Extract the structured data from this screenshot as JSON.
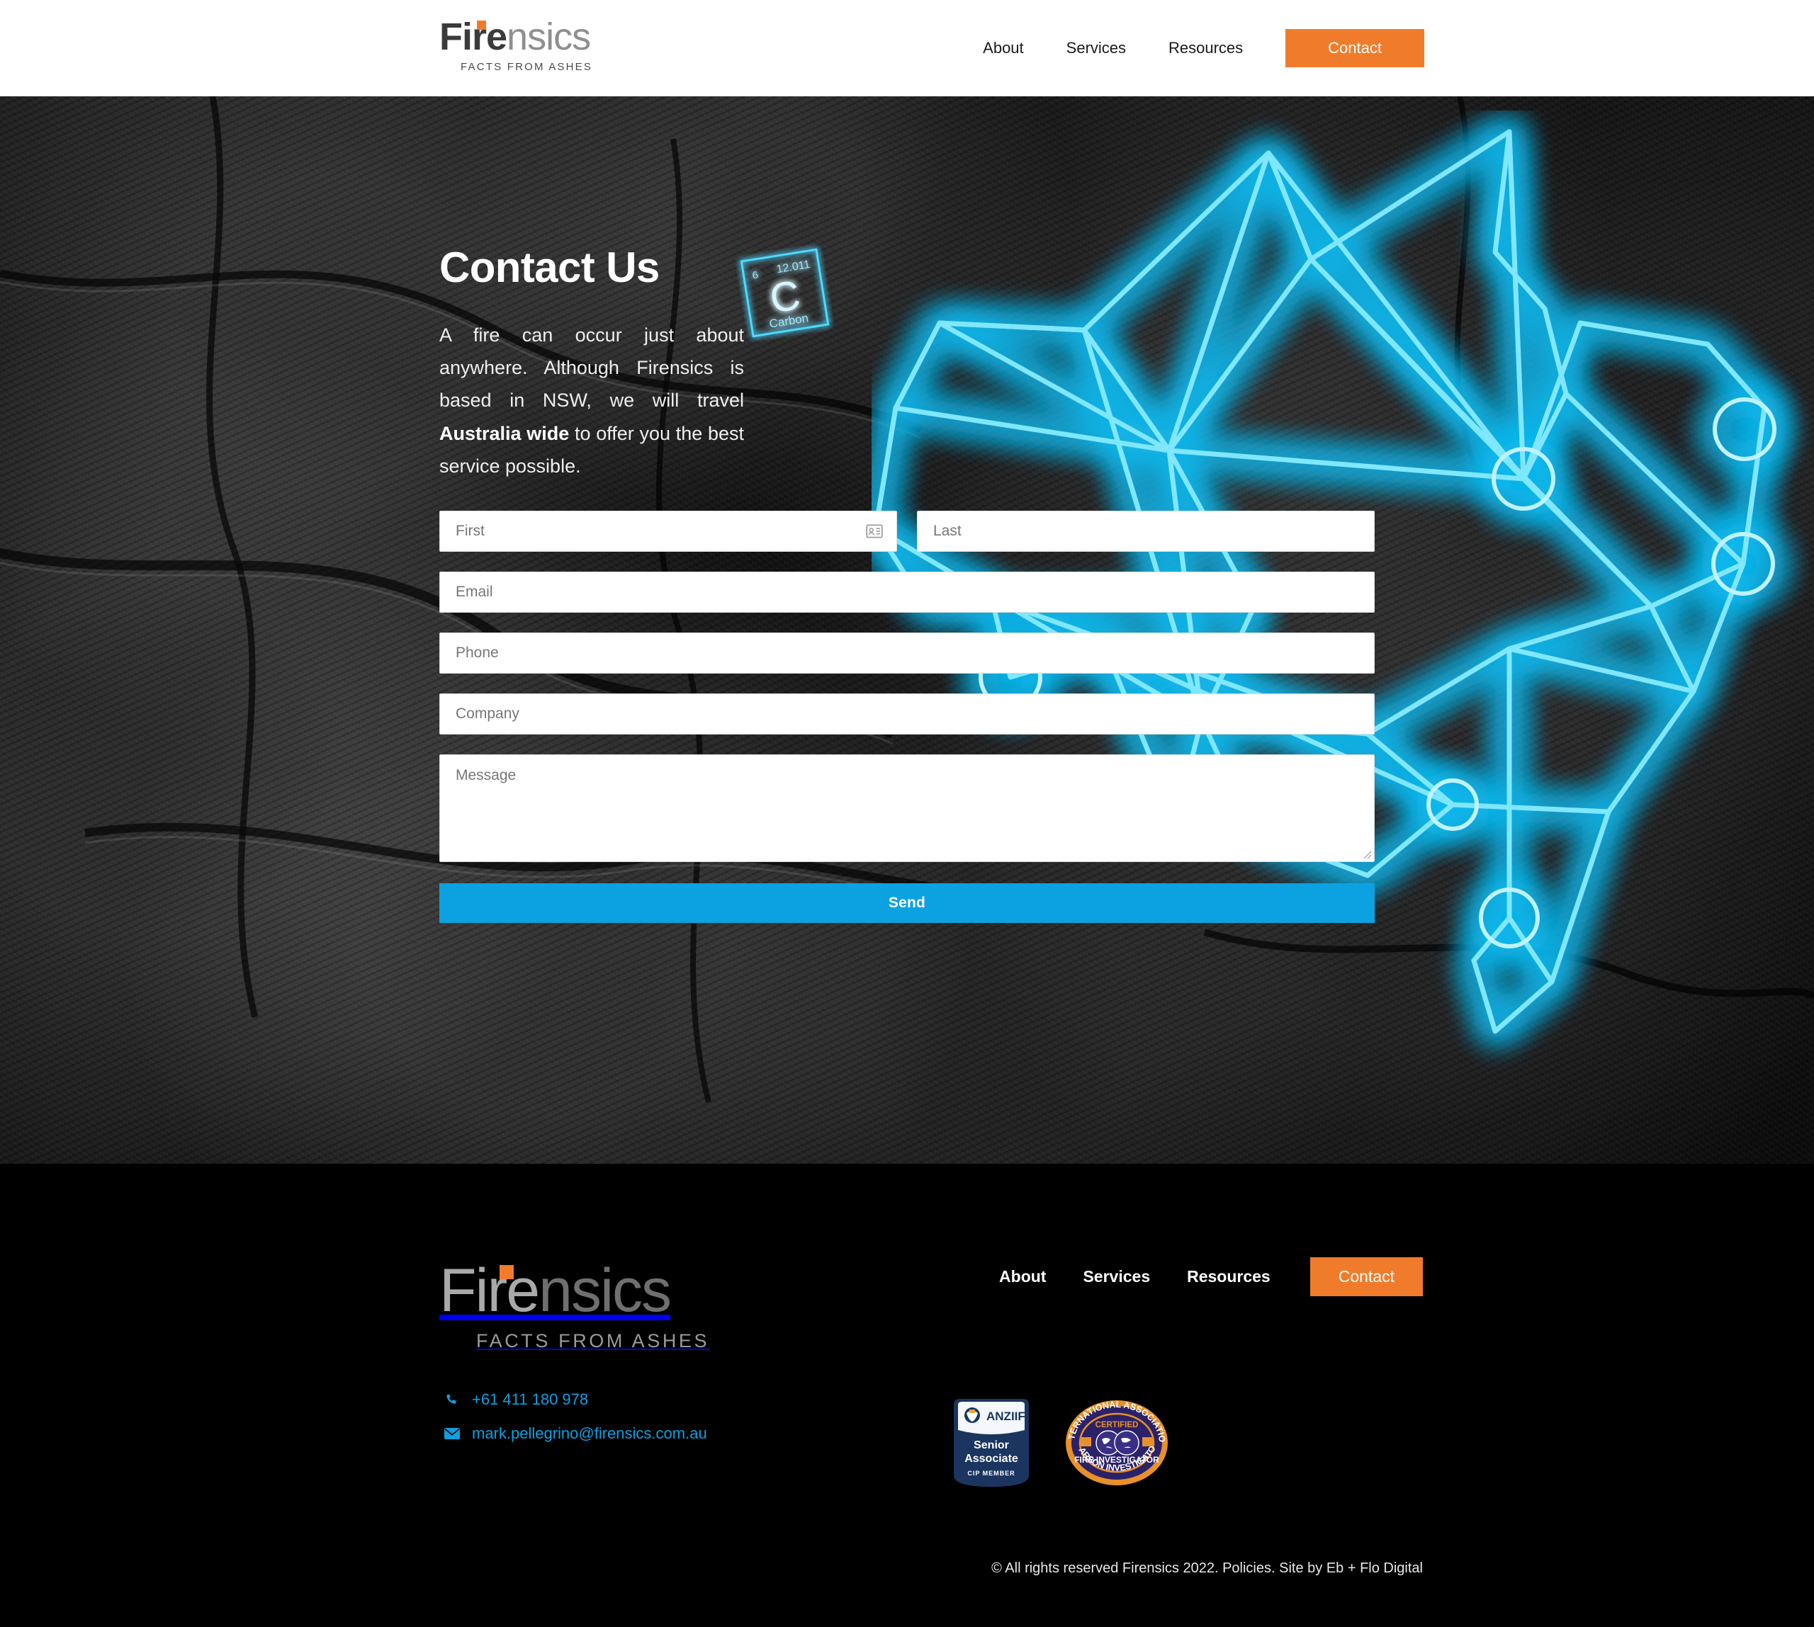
{
  "header": {
    "logo": {
      "text_bold": "Fire",
      "text_light": "nsics",
      "tagline": "FACTS FROM ASHES",
      "dot_color": "#f07c2b"
    },
    "nav": [
      {
        "label": "About",
        "cta": false
      },
      {
        "label": "Services",
        "cta": false
      },
      {
        "label": "Resources",
        "cta": false
      },
      {
        "label": "Contact",
        "cta": true
      }
    ]
  },
  "hero": {
    "title": "Contact Us",
    "paragraph_part1": "A fire can occur just about anywhere. Although Firensics is based in NSW, we will travel ",
    "paragraph_bold": "Australia wide",
    "paragraph_part2": " to offer you the best service possible.",
    "carbon_tile": {
      "atomic_number": "6",
      "atomic_mass": "12.011",
      "symbol": "C",
      "name": "Carbon",
      "color": "#4fd8ff"
    },
    "map": {
      "label": "australia-neon-network-map",
      "line_color": "#2ec8f5",
      "glow_color": "#0bb6ef"
    }
  },
  "form": {
    "first_placeholder": "First",
    "first_value": "",
    "last_placeholder": "Last",
    "last_value": "",
    "email_placeholder": "Email",
    "email_value": "",
    "phone_placeholder": "Phone",
    "phone_value": "",
    "company_placeholder": "Company",
    "company_value": "",
    "message_placeholder": "Message",
    "message_value": "",
    "send_label": "Send",
    "send_color": "#0ca2e2"
  },
  "footer": {
    "logo": {
      "text_bold": "Fire",
      "text_light": "nsics",
      "tagline": "FACTS FROM ASHES",
      "dot_color": "#f07c2b"
    },
    "phone": "+61 411 180 978",
    "email": "mark.pellegrino@firensics.com.au",
    "link_color": "#0f9fe0",
    "nav": [
      {
        "label": "About",
        "cta": false
      },
      {
        "label": "Services",
        "cta": false
      },
      {
        "label": "Resources",
        "cta": false
      },
      {
        "label": "Contact",
        "cta": true
      }
    ],
    "badges": [
      {
        "name": "anziif-senior-associate-badge",
        "brand": "ANZIIF",
        "line1": "Senior",
        "line2": "Associate",
        "line3": "CIP MEMBER"
      },
      {
        "name": "iaai-certified-fire-investigator-badge",
        "top_text": "INTERNATIONAL ASSOCIATION",
        "bottom_text": "OF ARSON INVESTIGATORS",
        "certified": "CERTIFIED",
        "role": "FIRE INVESTIGATOR"
      }
    ],
    "copyright": "© All rights reserved Firensics 2022. Policies. Site by Eb + Flo Digital"
  }
}
